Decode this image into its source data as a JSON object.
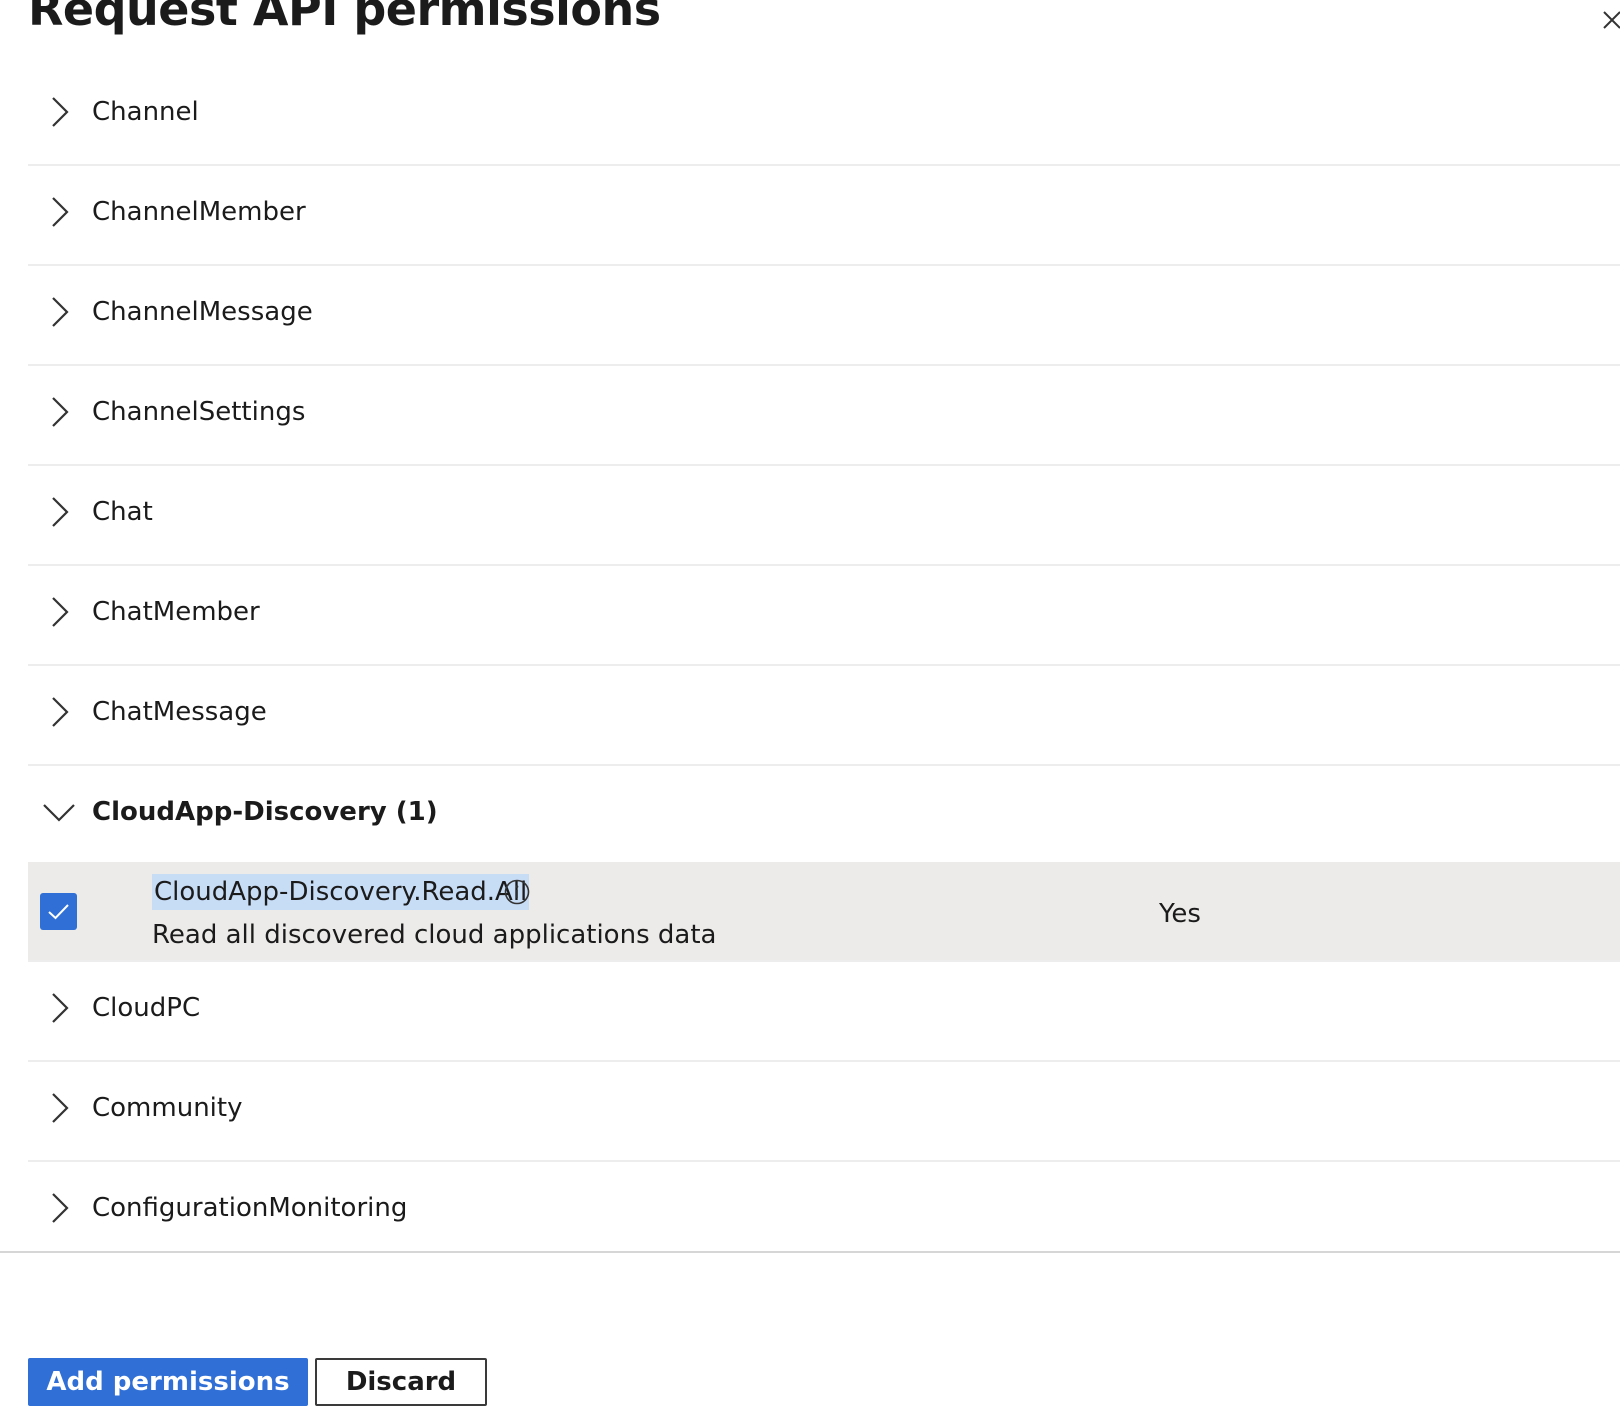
{
  "panel": {
    "title": "Request API permissions"
  },
  "groups_before": [
    {
      "label": "Channel"
    },
    {
      "label": "ChannelMember"
    },
    {
      "label": "ChannelMessage"
    },
    {
      "label": "ChannelSettings"
    },
    {
      "label": "Chat"
    },
    {
      "label": "ChatMember"
    },
    {
      "label": "ChatMessage"
    }
  ],
  "expanded_group": {
    "label": "CloudApp-Discovery (1)",
    "permissions": [
      {
        "name": "CloudApp-Discovery.Read.All",
        "description": "Read all discovered cloud applications data",
        "admin_consent_required": "Yes",
        "checked": true
      }
    ]
  },
  "groups_after": [
    {
      "label": "CloudPC"
    },
    {
      "label": "Community"
    },
    {
      "label": "ConfigurationMonitoring"
    }
  ],
  "footer": {
    "add_label": "Add permissions",
    "discard_label": "Discard"
  },
  "colors": {
    "accent": "#2f6fd6",
    "selected_row": "#edebe9",
    "text_highlight": "#c7dcf5"
  }
}
